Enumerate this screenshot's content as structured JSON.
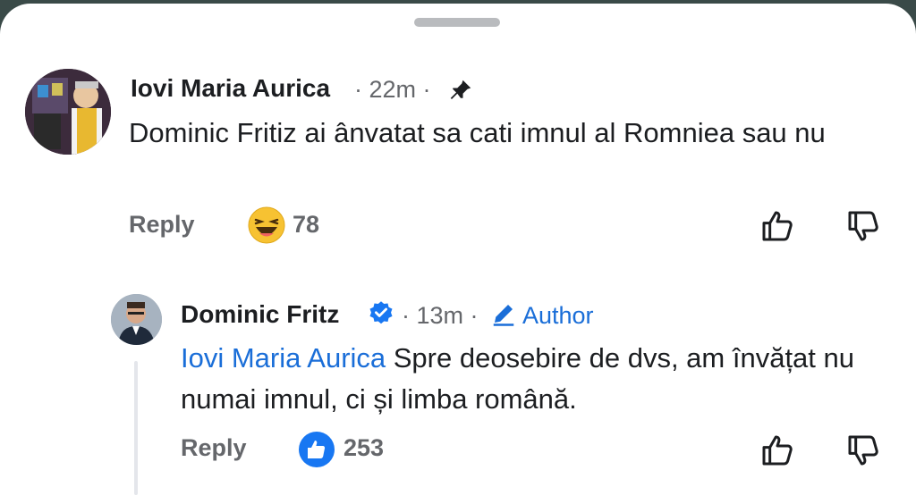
{
  "comments": [
    {
      "author": "Iovi Maria Aurica",
      "time": "· 22m ·",
      "text": "Dominic Fritiz ai ânvatat sa cati imnul al Romniea sau nu",
      "reply_label": "Reply",
      "reaction_icon": "laugh-emoji",
      "reaction_count": "78",
      "pinned": true
    },
    {
      "author": "Dominic Fritz",
      "verified": true,
      "time": "· 13m ·",
      "author_tag": "Author",
      "mention": "Iovi Maria Aurica",
      "text": " Spre deosebire de dvs, am învățat nu numai imnul, ci și limba română.",
      "reply_label": "Reply",
      "reaction_icon": "like-thumb",
      "reaction_count": "253"
    }
  ],
  "colors": {
    "link": "#1a6ed8",
    "meta": "#65676b",
    "like": "#1877f2"
  }
}
